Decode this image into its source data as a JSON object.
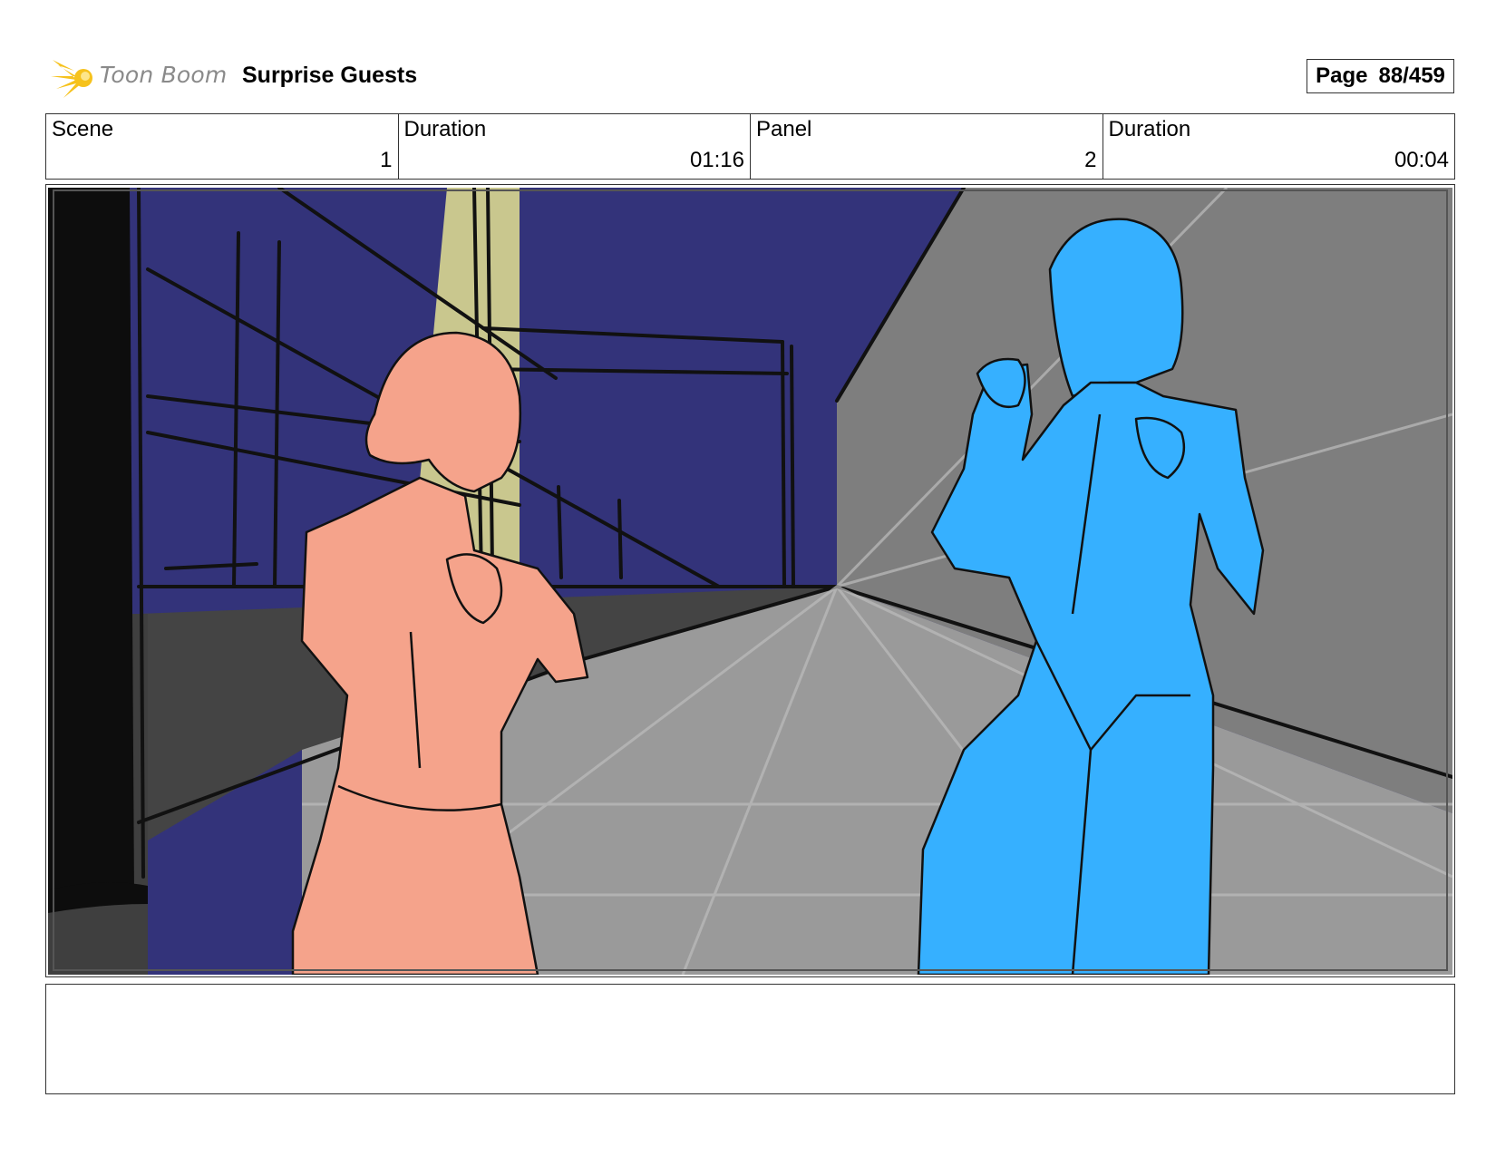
{
  "header": {
    "brand": "Toon Boom",
    "title": "Surprise Guests",
    "page_label": "Page",
    "page_number": "88/459"
  },
  "info": {
    "scene_label": "Scene",
    "scene_value": "1",
    "scene_duration_label": "Duration",
    "scene_duration_value": "01:16",
    "panel_label": "Panel",
    "panel_value": "2",
    "panel_duration_label": "Duration",
    "panel_duration_value": "00:04"
  },
  "notes": {
    "text": ""
  },
  "colors": {
    "night_sky": "#33337a",
    "wall_gray": "#7e7e7e",
    "floor_gray": "#9a9a9a",
    "dark_floor": "#3f3f3f",
    "spotlight": "#c9c78e",
    "left_character": "#f5a38b",
    "right_character": "#36b0ff",
    "logo_yellow": "#f6c21c"
  },
  "icons": {
    "logo": "toon-boom-logo-icon"
  }
}
